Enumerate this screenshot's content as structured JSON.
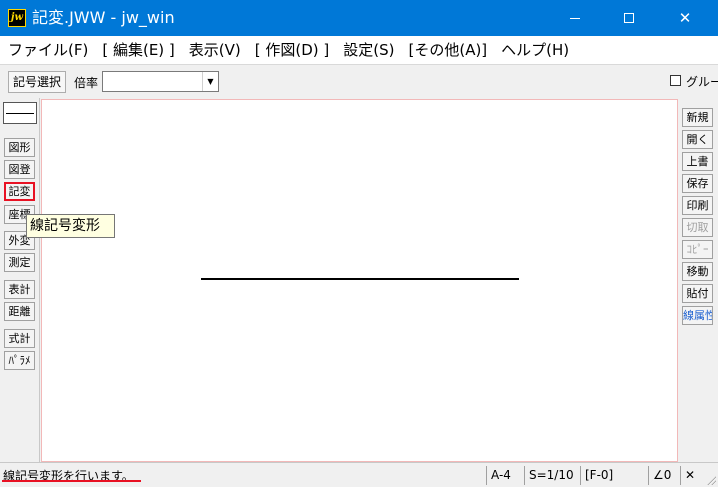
{
  "window": {
    "app_icon": "jw",
    "title": "記変.JWW - jw_win",
    "minimize_icon": "minimize-icon",
    "maximize_icon": "maximize-icon",
    "close_glyph": "✕"
  },
  "menu": {
    "items": [
      {
        "label": "ファイル(F)"
      },
      {
        "label": "[ 編集(E) ]"
      },
      {
        "label": "表示(V)"
      },
      {
        "label": "[ 作図(D) ]"
      },
      {
        "label": "設定(S)"
      },
      {
        "label": "[その他(A)]"
      },
      {
        "label": "ヘルプ(H)"
      }
    ]
  },
  "toolbar": {
    "symbol_select_label": "記号選択",
    "scale_label": "倍率",
    "scale_value": "",
    "combo_arrow": "▼",
    "group_label": "グルー"
  },
  "left_tools": [
    {
      "label": "図形"
    },
    {
      "label": "図登"
    },
    {
      "label": "記変"
    },
    {
      "label": "座標"
    },
    {
      "label": "外変"
    },
    {
      "label": "測定"
    },
    {
      "label": "表計"
    },
    {
      "label": "距離"
    },
    {
      "label": "式計"
    },
    {
      "label": "ﾊﾟﾗﾒ"
    }
  ],
  "right_tools": [
    {
      "label": "新規"
    },
    {
      "label": "開く"
    },
    {
      "label": "上書"
    },
    {
      "label": "保存"
    },
    {
      "label": "印刷"
    },
    {
      "label": "切取"
    },
    {
      "label": "ｺﾋﾟｰ"
    },
    {
      "label": "移動"
    },
    {
      "label": "貼付"
    },
    {
      "label": "線属性"
    }
  ],
  "tooltip": {
    "text": "線記号変形"
  },
  "status": {
    "message": "線記号変形を行います。",
    "paper": "A-4",
    "scale": "S=1/10",
    "layer": "[F-0]",
    "angle": "∠0",
    "close": "✕"
  },
  "colors": {
    "titlebar": "#0078d7",
    "highlight": "#e81123",
    "tooltip_bg": "#ffffe1"
  }
}
